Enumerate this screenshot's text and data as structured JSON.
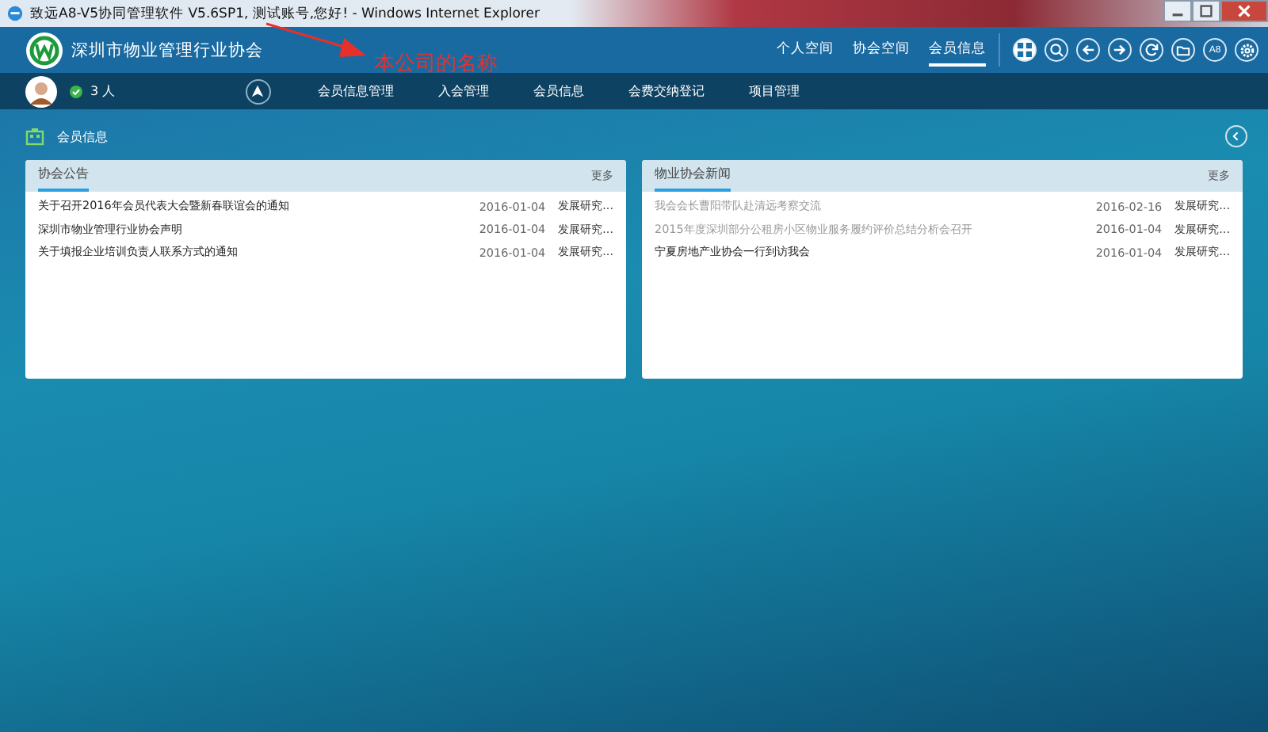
{
  "window": {
    "title": "致远A8-V5协同管理软件 V5.6SP1, 测试账号,您好! - Windows Internet Explorer"
  },
  "header": {
    "org_name": "深圳市物业管理行业协会",
    "top_nav": [
      {
        "label": "个人空间",
        "selected": false
      },
      {
        "label": "协会空间",
        "selected": false
      },
      {
        "label": "会员信息",
        "selected": true
      }
    ],
    "tool_label": "A8"
  },
  "annotation": {
    "text": "本公司的名称"
  },
  "user_bar": {
    "online_count": "3 人",
    "menu": [
      "会员信息管理",
      "入会管理",
      "会员信息",
      "会费交纳登记",
      "项目管理"
    ]
  },
  "section": {
    "title": "会员信息"
  },
  "panels": [
    {
      "title": "协会公告",
      "more": "更多",
      "items": [
        {
          "title": "关于召开2016年会员代表大会暨新春联谊会的通知",
          "date": "2016-01-04",
          "author": "发展研究...",
          "read": false
        },
        {
          "title": "深圳市物业管理行业协会声明",
          "date": "2016-01-04",
          "author": "发展研究...",
          "read": false
        },
        {
          "title": "关于填报企业培训负责人联系方式的通知",
          "date": "2016-01-04",
          "author": "发展研究...",
          "read": false
        }
      ]
    },
    {
      "title": "物业协会新闻",
      "more": "更多",
      "items": [
        {
          "title": "我会会长曹阳带队赴清远考察交流",
          "date": "2016-02-16",
          "author": "发展研究...",
          "read": true
        },
        {
          "title": "2015年度深圳部分公租房小区物业服务履约评价总结分析会召开",
          "date": "2016-01-04",
          "author": "发展研究...",
          "read": true
        },
        {
          "title": "宁夏房地产业协会一行到访我会",
          "date": "2016-01-04",
          "author": "发展研究...",
          "read": false
        }
      ]
    }
  ]
}
